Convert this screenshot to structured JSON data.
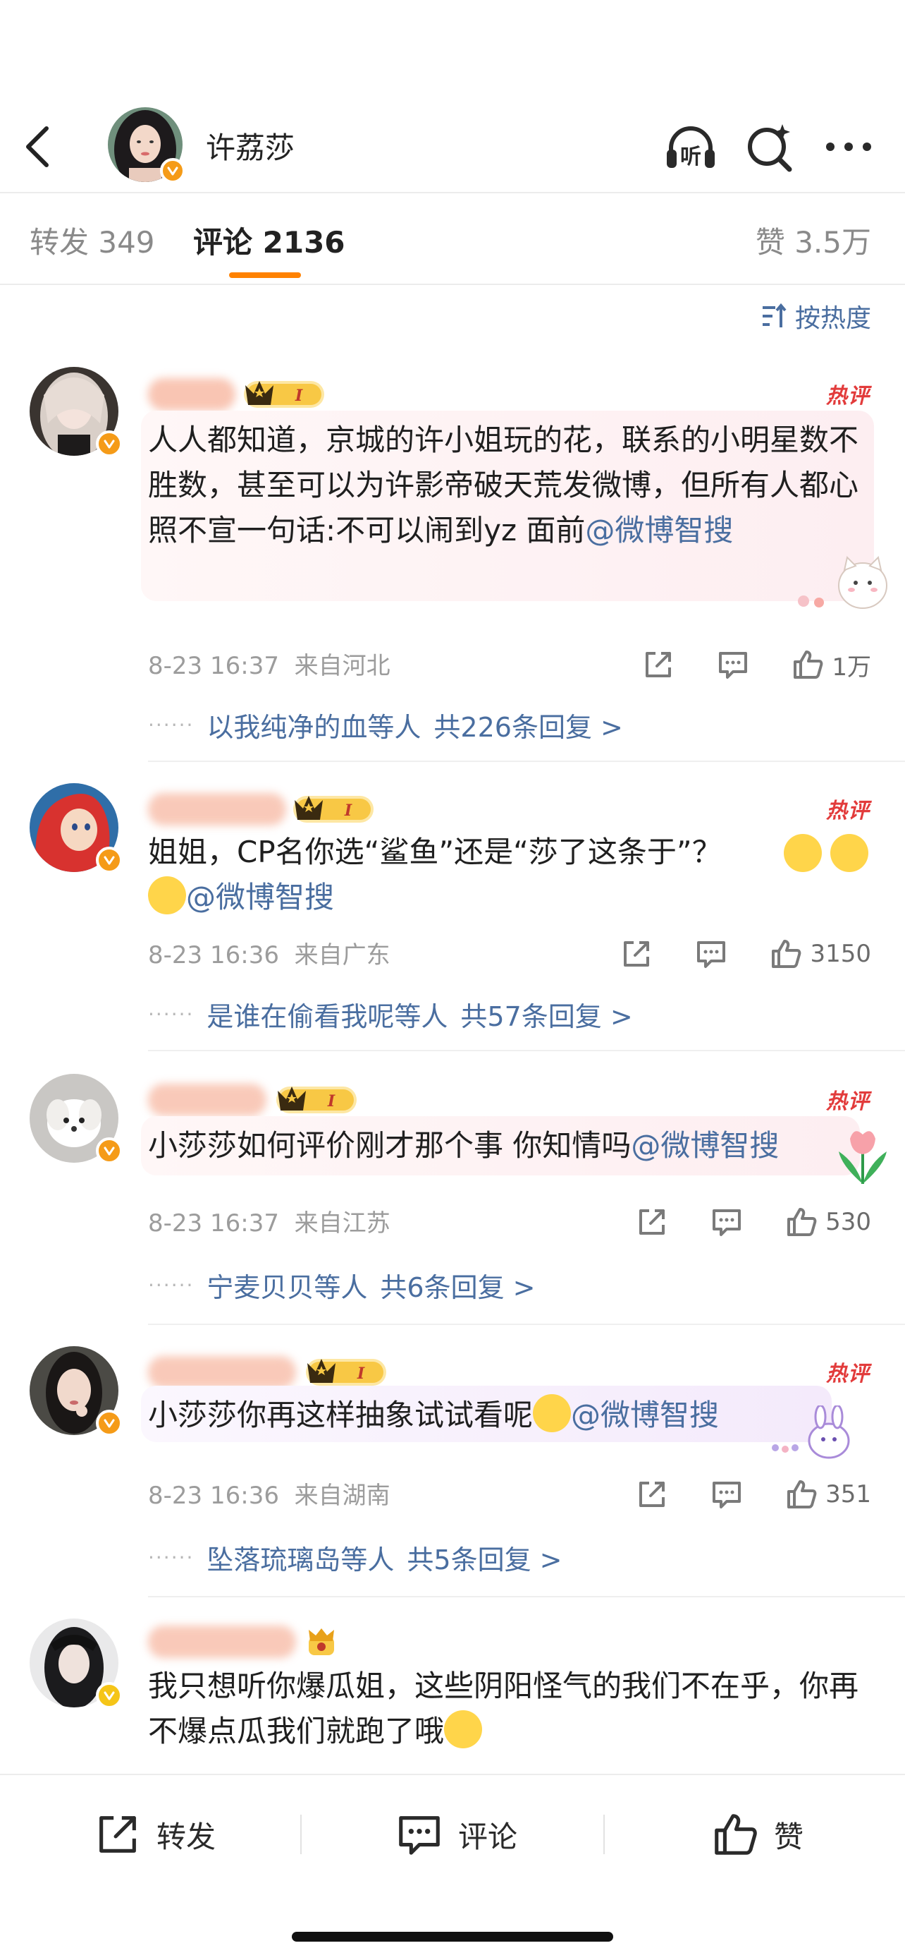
{
  "header": {
    "title": "许荔莎",
    "listen_label": "听"
  },
  "tabs": {
    "repost": "转发 349",
    "comment": "评论 2136",
    "like": "赞 3.5万"
  },
  "sort_label": "按热度",
  "hot_label": "热评",
  "comments": [
    {
      "text": "人人都知道，京城的许小姐玩的花，联系的小明星数不胜数，甚至可以为许影帝破天荒发微博，但所有人都心照不宣一句话:不可以闹到yz 面前",
      "mention": "@微博智搜",
      "time": "8-23 16:37",
      "location": "来自河北",
      "likes": "1万",
      "reply_users": "以我纯净的血等人",
      "reply_count": "共226条回复 >"
    },
    {
      "text": "姐姐，CP名你选“鲨鱼”还是“莎了这条于”？",
      "mention": "@微博智搜",
      "time": "8-23 16:36",
      "location": "来自广东",
      "likes": "3150",
      "reply_users": "是谁在偷看我呢等人",
      "reply_count": "共57条回复 >"
    },
    {
      "text": "小莎莎如何评价刚才那个事 你知情吗",
      "mention": "@微博智搜",
      "time": "8-23 16:37",
      "location": "来自江苏",
      "likes": "530",
      "reply_users": "宁麦贝贝等人",
      "reply_count": "共6条回复 >"
    },
    {
      "text": "小莎莎你再这样抽象试试看呢",
      "mention": "@微博智搜",
      "time": "8-23 16:36",
      "location": "来自湖南",
      "likes": "351",
      "reply_users": "坠落琉璃岛等人",
      "reply_count": "共5条回复 >"
    },
    {
      "text": "我只想听你爆瓜姐，这些阴阳怪气的我们不在乎，你再不爆点瓜我们就跑了哦"
    }
  ],
  "bottom": {
    "repost": "转发",
    "comment": "评论",
    "like": "赞"
  },
  "colors": {
    "accent": "#ff8200",
    "link": "#4a6ea0",
    "hot": "#e23b3b",
    "verified": "#f59b18"
  }
}
